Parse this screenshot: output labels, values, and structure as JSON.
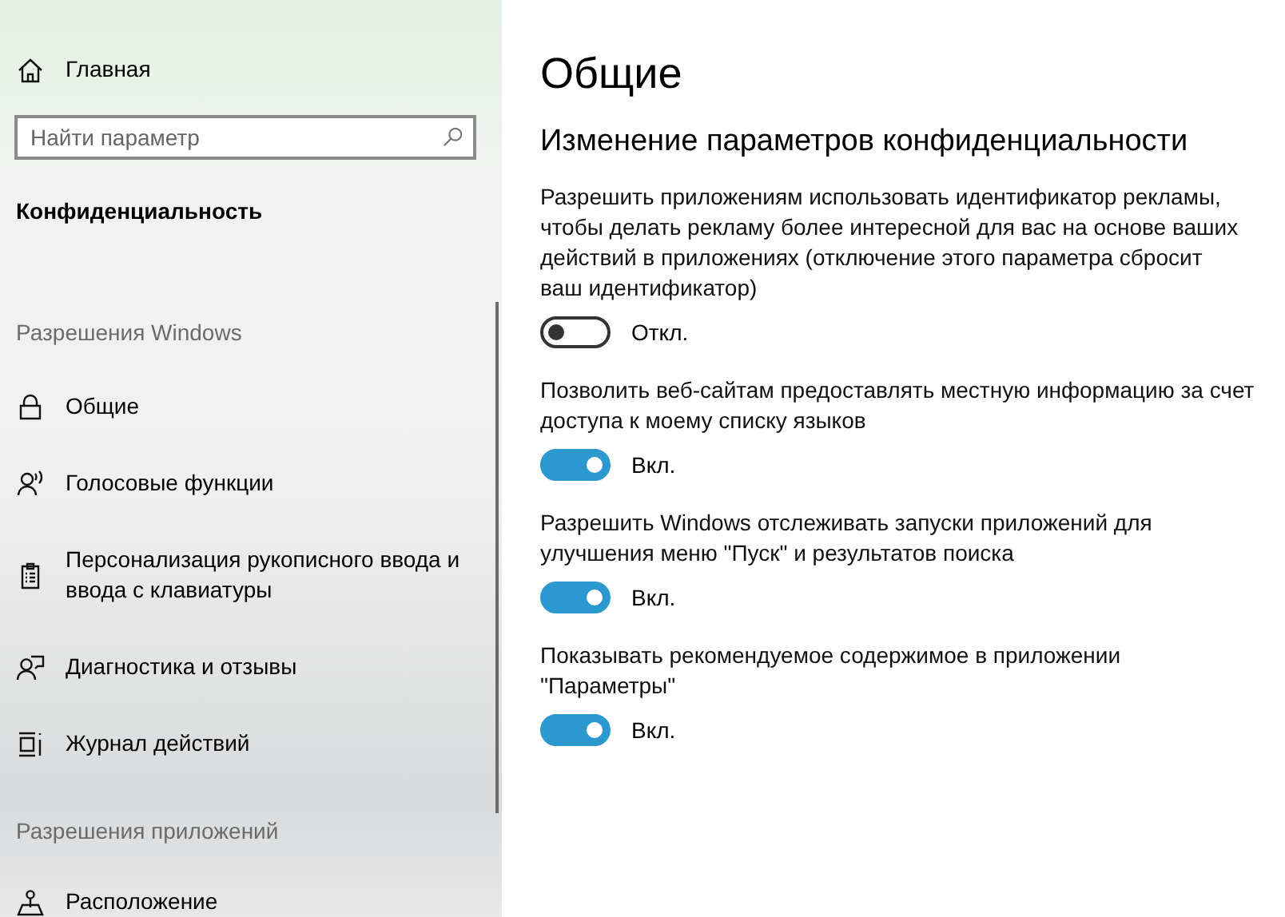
{
  "sidebar": {
    "home": {
      "label": "Главная",
      "kind": "home"
    },
    "search": {
      "placeholder": "Найти параметр"
    },
    "heading": "Конфиденциальность",
    "groups": [
      {
        "title": "Разрешения Windows",
        "items": [
          {
            "label": "Общие",
            "kind": "lock"
          },
          {
            "label": "Голосовые функции",
            "kind": "speech"
          },
          {
            "label": "Персонализация рукописного ввода и\nввода с клавиатуры",
            "kind": "clipboard"
          },
          {
            "label": "Диагностика и отзывы",
            "kind": "feedback"
          },
          {
            "label": "Журнал действий",
            "kind": "timeline"
          }
        ]
      },
      {
        "title": "Разрешения приложений",
        "items": [
          {
            "label": "Расположение",
            "kind": "location"
          }
        ]
      }
    ]
  },
  "page": {
    "title": "Общие",
    "subtitle": "Изменение параметров конфиденциальности",
    "settings": [
      {
        "text": "Разрешить приложениям использовать идентификатор рекламы,\nчтобы делать рекламу более интересной для вас на основе ваших\nдействий в приложениях (отключение этого параметра сбросит\nваш идентификатор)",
        "on": false,
        "state_label": "Откл."
      },
      {
        "text": "Позволить веб-сайтам предоставлять местную информацию за счет\nдоступа к моему списку языков",
        "on": true,
        "state_label": "Вкл."
      },
      {
        "text": "Разрешить Windows отслеживать запуски приложений для\nулучшения меню \"Пуск\" и результатов поиска",
        "on": true,
        "state_label": "Вкл."
      },
      {
        "text": "Показывать рекомендуемое содержимое в приложении\n\"Параметры\"",
        "on": true,
        "state_label": "Вкл."
      }
    ]
  }
}
